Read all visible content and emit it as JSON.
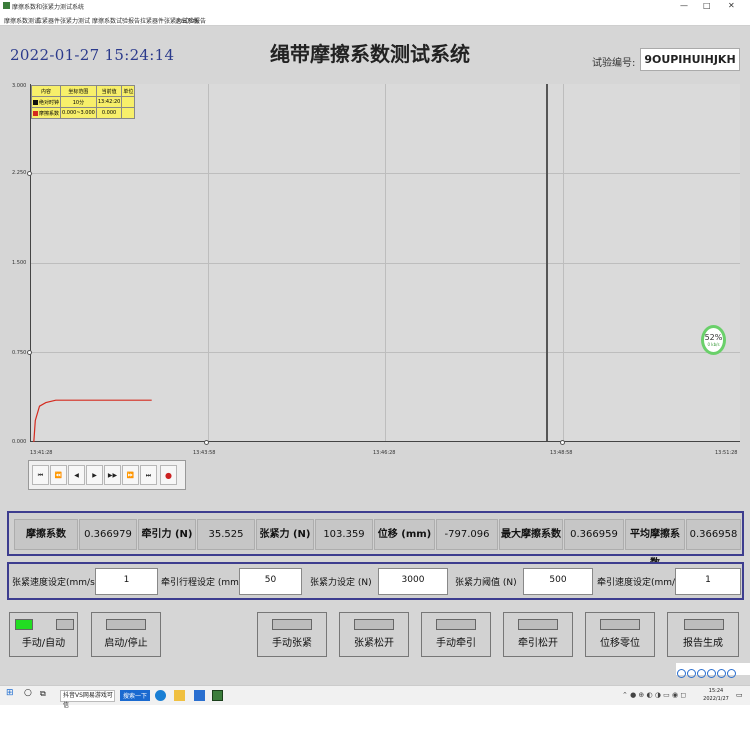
{
  "window": {
    "title": "摩擦系数和张紧力测试系统",
    "controls": [
      "—",
      "□",
      "✕"
    ]
  },
  "menu": [
    "摩擦系数测试",
    "拉紧器件张紧力测试",
    "摩擦系数试验报告",
    "拉紧器件张紧力试验报告",
    "退出系统"
  ],
  "header": {
    "datetime": "2022-01-27 15:24:14",
    "title": "绳带摩擦系数测试系统",
    "test_no_label": "试验编号:",
    "test_no": "9OUPIHUIHJKH"
  },
  "chart_data": {
    "type": "line",
    "y_ticks": [
      "3.000",
      "2.250",
      "1.500",
      "0.750",
      "0.000"
    ],
    "x_ticks": [
      "13:41:28",
      "13:43:58",
      "13:46:28",
      "13:48:58",
      "13:51:28"
    ],
    "ylim": [
      0,
      3
    ],
    "xlim": [
      0,
      10
    ],
    "grid": true,
    "cursor_x": 7.26,
    "legend": {
      "headers": [
        "内容",
        "坐标范围",
        "当前值",
        "单位"
      ],
      "rows": [
        {
          "swatch": "#111111",
          "name": "绝对时钟",
          "range": "10分",
          "current": "13:42:20",
          "unit": ""
        },
        {
          "swatch": "#d42a1e",
          "name": "摩擦系数",
          "range": "0.000~3.000",
          "current": "0.000",
          "unit": ""
        }
      ]
    },
    "series": [
      {
        "color": "#d42a1e",
        "x": [
          0.04,
          0.06,
          0.12,
          0.21,
          0.35,
          0.52,
          0.84,
          1.24,
          1.68,
          1.7
        ],
        "y": [
          0,
          0.18,
          0.3,
          0.33,
          0.35,
          0.35,
          0.35,
          0.35,
          0.35,
          0.35
        ]
      }
    ]
  },
  "progress": {
    "value": "52",
    "unit": "%",
    "sub": "0 kb/s"
  },
  "player": {
    "buttons": [
      "⏮",
      "⏪",
      "◀",
      "▶",
      "▶▶",
      "⏩",
      "⏭",
      "●"
    ]
  },
  "readouts": [
    {
      "label": "摩擦系数",
      "value": "0.366979"
    },
    {
      "label": "牵引力 (N)",
      "value": "35.525"
    },
    {
      "label": "张紧力 (N)",
      "value": "103.359"
    },
    {
      "label": "位移 (mm)",
      "value": "-797.096"
    },
    {
      "label": "最大摩擦系数",
      "value": "0.366959"
    },
    {
      "label": "平均摩擦系数",
      "value": "0.366958"
    }
  ],
  "settings": [
    {
      "label": "张紧速度设定(mm/s)",
      "value": "1"
    },
    {
      "label": "牵引行程设定 (mm)",
      "value": "50"
    },
    {
      "label": "张紧力设定 (N)",
      "value": "3000"
    },
    {
      "label": "张紧力阈值 (N)",
      "value": "500"
    },
    {
      "label": "牵引速度设定(mm/s)",
      "value": "1"
    }
  ],
  "controls": {
    "manual_auto": "手动/自动",
    "start_stop": "启动/停止",
    "manual_tension": "手动张紧",
    "tension_release": "张紧松开",
    "manual_pull": "手动牵引",
    "pull_release": "牵引松开",
    "disp_zero": "位移零位",
    "report": "报告生成",
    "manual_auto_color": "#22dd22"
  },
  "taskbar": {
    "search_text": "抖音VS网易游戏可信",
    "button": "搜索一下",
    "time": "15:24",
    "date": "2022/1/27"
  }
}
